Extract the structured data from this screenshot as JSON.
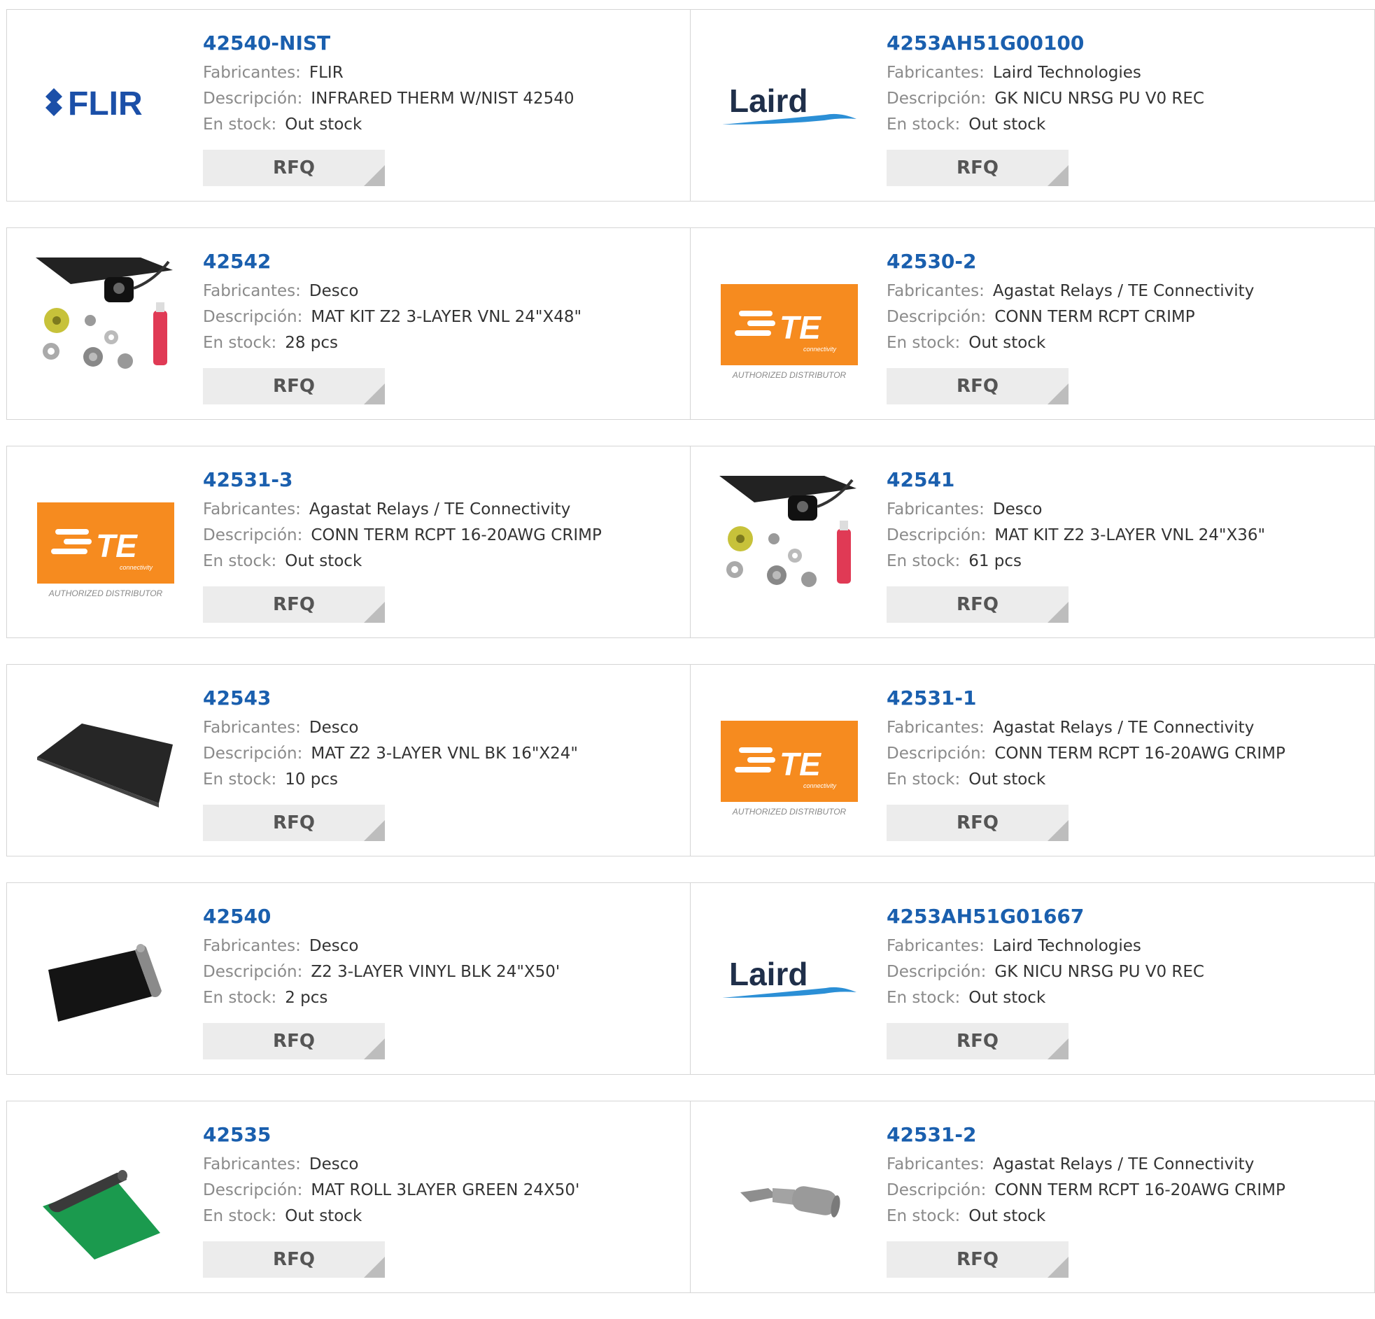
{
  "labels": {
    "manufacturer": "Fabricantes:",
    "description": "Descripción:",
    "stock": "En stock:",
    "rfq": "RFQ"
  },
  "logos": {
    "flir": "FLIR",
    "laird": "Laird",
    "te": "TE",
    "te_sub": "connectivity",
    "te_tag": "AUTHORIZED DISTRIBUTOR"
  },
  "colors": {
    "link": "#1a5fae",
    "te_orange": "#f68b1f",
    "laird_blue": "#2b8fd6",
    "mat_green": "#1b9a4e"
  },
  "products": [
    {
      "part": "42540-NIST",
      "manufacturer": "FLIR",
      "description": "INFRARED THERM W/NIST 42540",
      "stock": "Out stock",
      "image": "flir-logo"
    },
    {
      "part": "4253AH51G00100",
      "manufacturer": "Laird Technologies",
      "description": "GK NICU NRSG PU V0 REC",
      "stock": "Out stock",
      "image": "laird-logo"
    },
    {
      "part": "42542",
      "manufacturer": "Desco",
      "description": "MAT KIT Z2 3-LAYER VNL 24\"X48\"",
      "stock": "28 pcs",
      "image": "mat-kit-photo"
    },
    {
      "part": "42530-2",
      "manufacturer": "Agastat Relays / TE Connectivity",
      "description": "CONN TERM RCPT CRIMP",
      "stock": "Out stock",
      "image": "te-logo"
    },
    {
      "part": "42531-3",
      "manufacturer": "Agastat Relays / TE Connectivity",
      "description": "CONN TERM RCPT 16-20AWG CRIMP",
      "stock": "Out stock",
      "image": "te-logo"
    },
    {
      "part": "42541",
      "manufacturer": "Desco",
      "description": "MAT KIT Z2 3-LAYER VNL 24\"X36\"",
      "stock": "61 pcs",
      "image": "mat-kit-photo"
    },
    {
      "part": "42543",
      "manufacturer": "Desco",
      "description": "MAT Z2 3-LAYER VNL BK 16\"X24\"",
      "stock": "10 pcs",
      "image": "black-mat-photo"
    },
    {
      "part": "42531-1",
      "manufacturer": "Agastat Relays / TE Connectivity",
      "description": "CONN TERM RCPT 16-20AWG CRIMP",
      "stock": "Out stock",
      "image": "te-logo"
    },
    {
      "part": "42540",
      "manufacturer": "Desco",
      "description": "Z2 3-LAYER VINYL BLK 24\"X50'",
      "stock": "2 pcs",
      "image": "black-roll-photo"
    },
    {
      "part": "4253AH51G01667",
      "manufacturer": "Laird Technologies",
      "description": "GK NICU NRSG PU V0 REC",
      "stock": "Out stock",
      "image": "laird-logo"
    },
    {
      "part": "42535",
      "manufacturer": "Desco",
      "description": "MAT ROLL 3LAYER GREEN 24X50'",
      "stock": "Out stock",
      "image": "green-roll-photo"
    },
    {
      "part": "42531-2",
      "manufacturer": "Agastat Relays / TE Connectivity",
      "description": "CONN TERM RCPT 16-20AWG CRIMP",
      "stock": "Out stock",
      "image": "terminal-photo"
    }
  ]
}
